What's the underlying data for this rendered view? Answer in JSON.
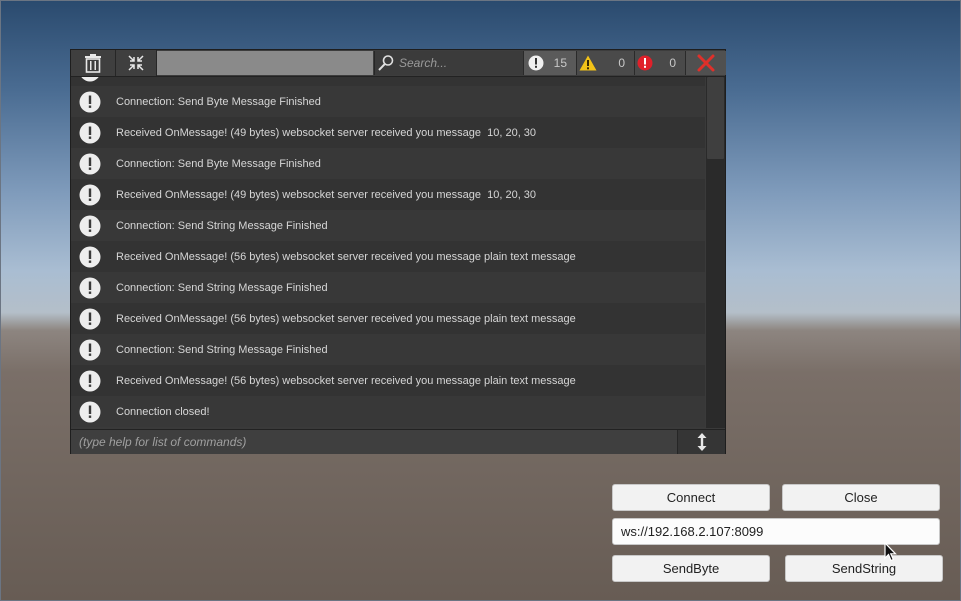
{
  "toolbar": {
    "trash_icon": "trash-icon",
    "collapse_icon": "collapse-icon",
    "search_placeholder": "Search...",
    "counts": {
      "info": "15",
      "warning": "0",
      "error": "0"
    },
    "colors": {
      "info": "#f0f0f0",
      "warning": "#f2c218",
      "error": "#e0202a",
      "close": "#e0302a"
    }
  },
  "log": {
    "rows": [
      "Connection: Send Byte Message Finished",
      "Received OnMessage! (49 bytes) websocket server received you message  10, 20, 30",
      "Connection: Send Byte Message Finished",
      "Received OnMessage! (49 bytes) websocket server received you message  10, 20, 30",
      "Connection: Send String Message Finished",
      "Received OnMessage! (56 bytes) websocket server received you message plain text message",
      "Connection: Send String Message Finished",
      "Received OnMessage! (56 bytes) websocket server received you message plain text message",
      "Connection: Send String Message Finished",
      "Received OnMessage! (56 bytes) websocket server received you message plain text message",
      "Connection closed!"
    ]
  },
  "command": {
    "placeholder": "(type help for list of commands)"
  },
  "controls": {
    "connect_label": "Connect",
    "close_label": "Close",
    "url_value": "ws://192.168.2.107:8099",
    "send_byte_label": "SendByte",
    "send_string_label": "SendString"
  }
}
